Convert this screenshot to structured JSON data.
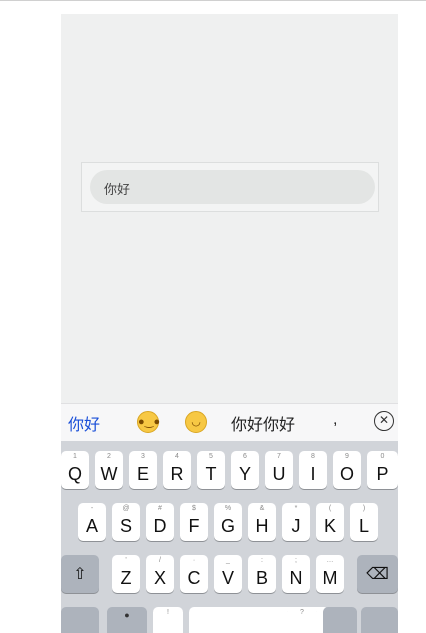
{
  "chat": {
    "input_text": "你好"
  },
  "candidates": [
    {
      "label": "你好",
      "selected": true
    },
    {
      "label": "你好你好",
      "selected": false
    },
    {
      "label": ",",
      "selected": false
    }
  ],
  "emoji_icons": [
    "grinning-face-icon",
    "smiling-face-icon"
  ],
  "keyboard": {
    "row1": [
      {
        "hint": "1",
        "char": "Q"
      },
      {
        "hint": "2",
        "char": "W"
      },
      {
        "hint": "3",
        "char": "E"
      },
      {
        "hint": "4",
        "char": "R"
      },
      {
        "hint": "5",
        "char": "T"
      },
      {
        "hint": "6",
        "char": "Y"
      },
      {
        "hint": "7",
        "char": "U"
      },
      {
        "hint": "8",
        "char": "I"
      },
      {
        "hint": "9",
        "char": "O"
      },
      {
        "hint": "0",
        "char": "P"
      }
    ],
    "row2": [
      {
        "hint": "-",
        "char": "A"
      },
      {
        "hint": "@",
        "char": "S"
      },
      {
        "hint": "#",
        "char": "D"
      },
      {
        "hint": "$",
        "char": "F"
      },
      {
        "hint": "%",
        "char": "G"
      },
      {
        "hint": "&",
        "char": "H"
      },
      {
        "hint": "*",
        "char": "J"
      },
      {
        "hint": "(",
        "char": "K"
      },
      {
        "hint": ")",
        "char": "L"
      }
    ],
    "row3": [
      {
        "hint": "'",
        "char": "Z"
      },
      {
        "hint": "/",
        "char": "X"
      },
      {
        "hint": "·",
        "char": "C"
      },
      {
        "hint": "_",
        "char": "V"
      },
      {
        "hint": ":",
        "char": "B"
      },
      {
        "hint": ";",
        "char": "N"
      },
      {
        "hint": "…",
        "char": "M"
      }
    ],
    "shift_glyph": "⇧",
    "delete_glyph": "⌫",
    "row4_hints": [
      "!",
      "?"
    ]
  },
  "colors": {
    "selected_candidate": "#1a4fd8",
    "keyboard_bg": "#d1d4d9",
    "key_bg": "#ffffff",
    "function_key_bg": "#adb3bc"
  }
}
